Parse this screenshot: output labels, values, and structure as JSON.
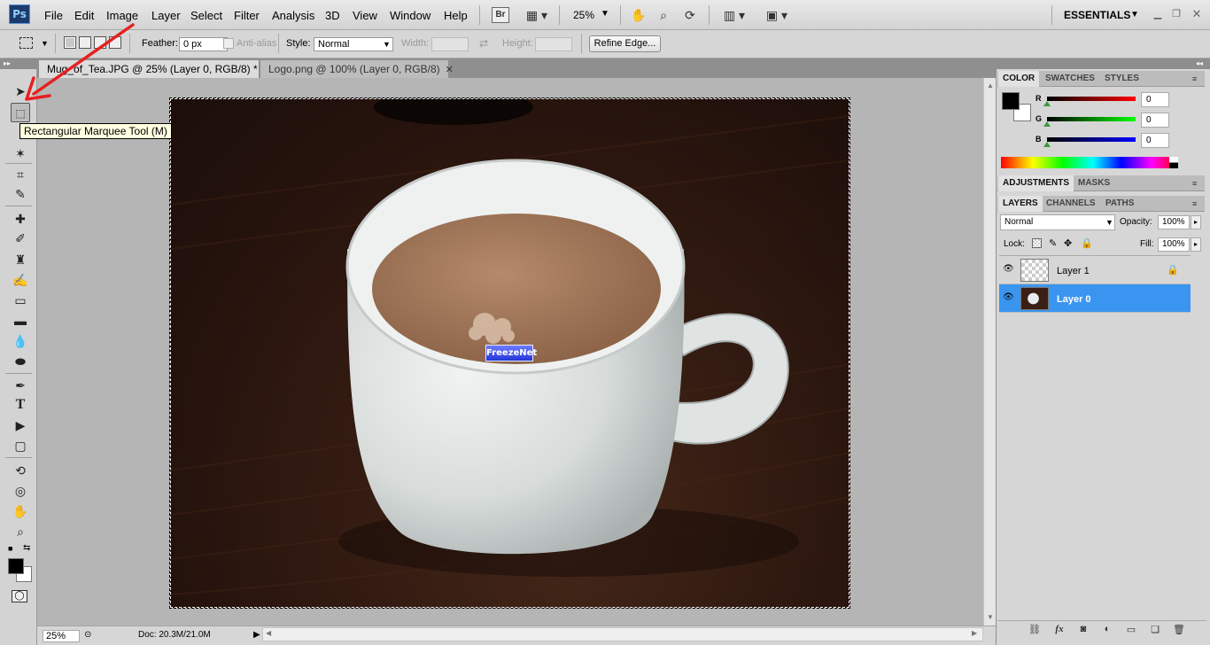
{
  "app": {
    "logo_text": "Ps",
    "menu": [
      "File",
      "Edit",
      "Image",
      "Layer",
      "Select",
      "Filter",
      "Analysis",
      "3D",
      "View",
      "Window",
      "Help"
    ],
    "bridge_label": "Br",
    "zoom_select": "25%",
    "workspace": "ESSENTIALS"
  },
  "options": {
    "feather_label": "Feather:",
    "feather_value": "0 px",
    "anti_alias_label": "Anti-alias",
    "style_label": "Style:",
    "style_value": "Normal",
    "width_label": "Width:",
    "height_label": "Height:",
    "refine_edge_label": "Refine Edge..."
  },
  "tools": {
    "tooltip": "Rectangular Marquee Tool (M)"
  },
  "documents": {
    "tabs": [
      {
        "label": "Mug_of_Tea.JPG @ 25% (Layer 0, RGB/8) *",
        "active": true
      },
      {
        "label": "Logo.png @ 100% (Layer 0, RGB/8)",
        "active": false
      }
    ],
    "close_glyph": "✕",
    "watermark_text": "FreezeNet"
  },
  "status": {
    "zoom": "25%",
    "doc_info": "Doc: 20.3M/21.0M"
  },
  "color_panel": {
    "tabs": [
      "COLOR",
      "SWATCHES",
      "STYLES"
    ],
    "channels": [
      {
        "label": "R",
        "value": "0",
        "color": "#cc0000"
      },
      {
        "label": "G",
        "value": "0",
        "color": "#00bb00"
      },
      {
        "label": "B",
        "value": "0",
        "color": "#0000cc"
      }
    ],
    "foreground_color": "#000000",
    "background_color": "#ffffff"
  },
  "adjustments_panel": {
    "tabs": [
      "ADJUSTMENTS",
      "MASKS"
    ]
  },
  "layers_panel": {
    "tabs": [
      "LAYERS",
      "CHANNELS",
      "PATHS"
    ],
    "blend_mode": "Normal",
    "opacity_label": "Opacity:",
    "opacity_value": "100%",
    "lock_label": "Lock:",
    "fill_label": "Fill:",
    "fill_value": "100%",
    "layers": [
      {
        "name": "Layer 1",
        "selected": false,
        "locked": true
      },
      {
        "name": "Layer 0",
        "selected": true,
        "locked": false
      }
    ],
    "selection_color": "#3a95f0"
  }
}
